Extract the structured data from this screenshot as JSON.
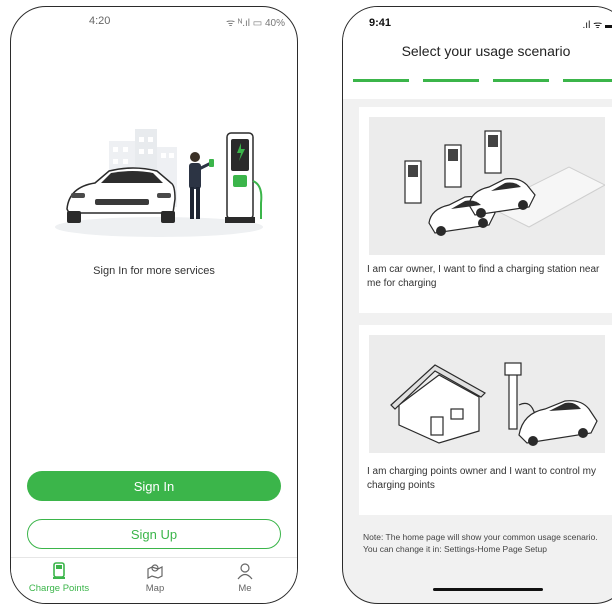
{
  "left_screen": {
    "status_bar": {
      "time": "4:20",
      "indicators": "ᯤ ᴺ.ıl ▭ 40%"
    },
    "prompt": "Sign In for more services",
    "sign_in_label": "Sign In",
    "sign_up_label": "Sign Up",
    "tabs": [
      {
        "label": "Charge Points",
        "icon": "charger-icon",
        "active": true
      },
      {
        "label": "Map",
        "icon": "map-icon",
        "active": false
      },
      {
        "label": "Me",
        "icon": "user-icon",
        "active": false
      }
    ]
  },
  "right_screen": {
    "status_bar": {
      "time": "9:41",
      "indicators": ".ıl ᯤ ▬"
    },
    "title": "Select your usage scenario",
    "progress_segments": 4,
    "options": [
      {
        "text": "I am car owner, I want to find a charging station near me for charging",
        "image": "charging-station-illustration"
      },
      {
        "text": "I am charging points owner and I want to control my charging points",
        "image": "home-charger-illustration"
      }
    ],
    "note": "Note: The home page will show your common usage scenario. You can change it in: Settings-Home Page Setup"
  },
  "colors": {
    "accent": "#3bb54a",
    "frame": "#2b2b2b",
    "background": "#f1f1f1"
  }
}
